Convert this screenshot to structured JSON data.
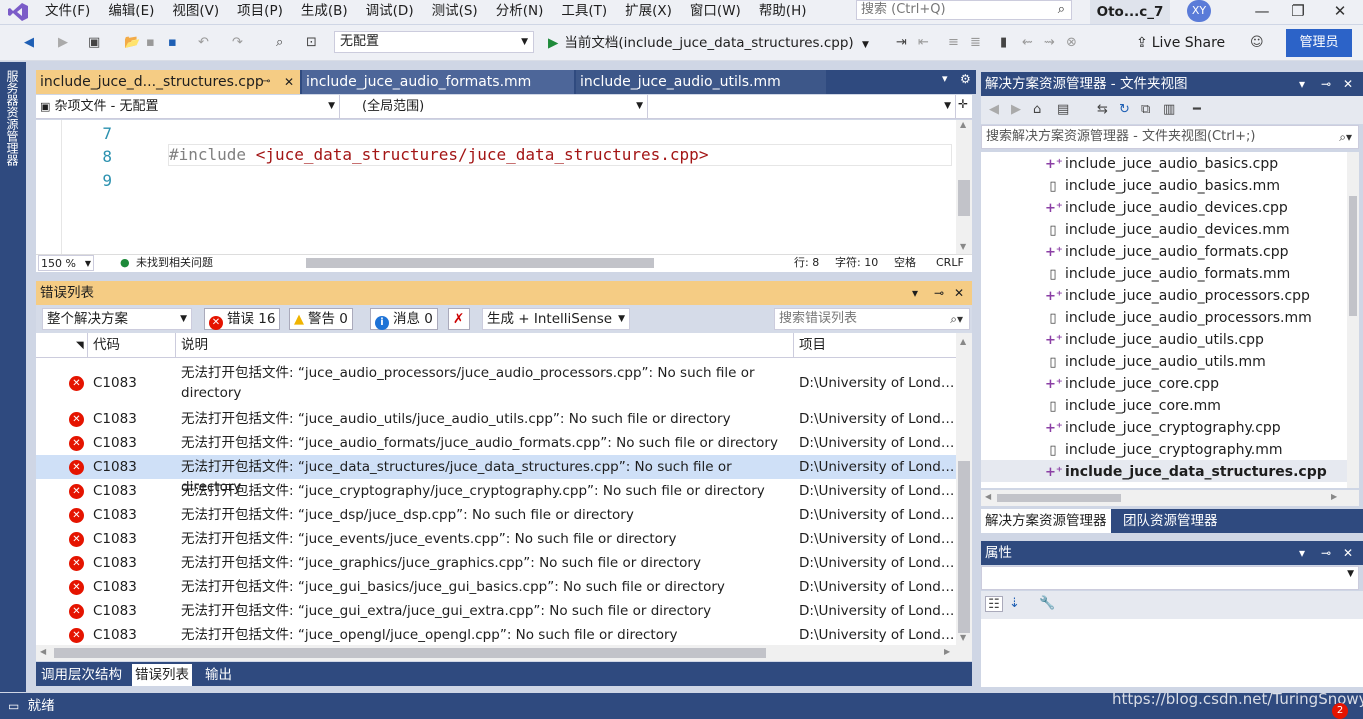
{
  "menu": {
    "items": [
      "文件(F)",
      "编辑(E)",
      "视图(V)",
      "项目(P)",
      "生成(B)",
      "调试(D)",
      "测试(S)",
      "分析(N)",
      "工具(T)",
      "扩展(X)",
      "窗口(W)",
      "帮助(H)"
    ],
    "search_placeholder": "搜索 (Ctrl+Q)",
    "project_title": "Oto...c_7",
    "avatar_initials": "XY"
  },
  "toolbar": {
    "config": "无配置",
    "run_label": "当前文档(include_juce_data_structures.cpp)",
    "liveshare": "Live Share",
    "admin": "管理员"
  },
  "left_strip": {
    "label": "服务器资源管理器"
  },
  "doc_tabs": [
    {
      "label": "include_juce_d..._structures.cpp"
    },
    {
      "label": "include_juce_audio_formats.mm"
    },
    {
      "label": "include_juce_audio_utils.mm"
    }
  ],
  "nav": {
    "file_scope": "杂项文件 - 无配置",
    "scope": "(全局范围)"
  },
  "editor": {
    "line_numbers": [
      "7",
      "8",
      "9"
    ],
    "directive": "#include",
    "include_path": "<juce_data_structures/juce_data_structures.cpp>",
    "zoom": "150 %",
    "no_issues": "未找到相关问题",
    "row": "行: 8",
    "col": "字符: 10",
    "spaces": "空格",
    "eol": "CRLF"
  },
  "error_list": {
    "title": "错误列表",
    "scope": "整个解决方案",
    "errors_label": "错误 16",
    "warnings_label": "警告 0",
    "messages_label": "消息 0",
    "build_filter": "生成 + IntelliSense",
    "search_placeholder": "搜索错误列表",
    "columns": {
      "code": "代码",
      "desc": "说明",
      "project": "项目"
    },
    "rows": [
      {
        "code": "C1083",
        "desc": "无法打开包括文件: “juce_audio_processors/juce_audio_processors.cpp”: No such file or directory",
        "project": "D:\\University of Londo..."
      },
      {
        "code": "C1083",
        "desc": "无法打开包括文件: “juce_audio_utils/juce_audio_utils.cpp”: No such file or directory",
        "project": "D:\\University of Londo..."
      },
      {
        "code": "C1083",
        "desc": "无法打开包括文件: “juce_audio_formats/juce_audio_formats.cpp”: No such file or directory",
        "project": "D:\\University of Londo..."
      },
      {
        "code": "C1083",
        "desc": "无法打开包括文件: “juce_data_structures/juce_data_structures.cpp”: No such file or directory",
        "project": "D:\\University of Londo..."
      },
      {
        "code": "C1083",
        "desc": "无法打开包括文件: “juce_cryptography/juce_cryptography.cpp”: No such file or directory",
        "project": "D:\\University of Londo..."
      },
      {
        "code": "C1083",
        "desc": "无法打开包括文件: “juce_dsp/juce_dsp.cpp”: No such file or directory",
        "project": "D:\\University of Londo..."
      },
      {
        "code": "C1083",
        "desc": "无法打开包括文件: “juce_events/juce_events.cpp”: No such file or directory",
        "project": "D:\\University of Londo..."
      },
      {
        "code": "C1083",
        "desc": "无法打开包括文件: “juce_graphics/juce_graphics.cpp”: No such file or directory",
        "project": "D:\\University of Londo..."
      },
      {
        "code": "C1083",
        "desc": "无法打开包括文件: “juce_gui_basics/juce_gui_basics.cpp”: No such file or directory",
        "project": "D:\\University of Londo..."
      },
      {
        "code": "C1083",
        "desc": "无法打开包括文件: “juce_gui_extra/juce_gui_extra.cpp”: No such file or directory",
        "project": "D:\\University of Londo..."
      },
      {
        "code": "C1083",
        "desc": "无法打开包括文件: “juce_opengl/juce_opengl.cpp”: No such file or directory",
        "project": "D:\\University of Londo..."
      }
    ]
  },
  "bottom_tabs": [
    "调用层次结构",
    "错误列表",
    "输出"
  ],
  "solution": {
    "title": "解决方案资源管理器 - 文件夹视图",
    "search_placeholder": "搜索解决方案资源管理器 - 文件夹视图(Ctrl+;)",
    "files": [
      {
        "name": "include_juce_audio_basics.cpp",
        "kind": "cpp"
      },
      {
        "name": "include_juce_audio_basics.mm",
        "kind": "mm"
      },
      {
        "name": "include_juce_audio_devices.cpp",
        "kind": "cpp"
      },
      {
        "name": "include_juce_audio_devices.mm",
        "kind": "mm"
      },
      {
        "name": "include_juce_audio_formats.cpp",
        "kind": "cpp"
      },
      {
        "name": "include_juce_audio_formats.mm",
        "kind": "mm"
      },
      {
        "name": "include_juce_audio_processors.cpp",
        "kind": "cpp"
      },
      {
        "name": "include_juce_audio_processors.mm",
        "kind": "mm"
      },
      {
        "name": "include_juce_audio_utils.cpp",
        "kind": "cpp"
      },
      {
        "name": "include_juce_audio_utils.mm",
        "kind": "mm"
      },
      {
        "name": "include_juce_core.cpp",
        "kind": "cpp"
      },
      {
        "name": "include_juce_core.mm",
        "kind": "mm"
      },
      {
        "name": "include_juce_cryptography.cpp",
        "kind": "cpp"
      },
      {
        "name": "include_juce_cryptography.mm",
        "kind": "mm"
      },
      {
        "name": "include_juce_data_structures.cpp",
        "kind": "cpp"
      }
    ],
    "tabs": [
      "解决方案资源管理器",
      "团队资源管理器"
    ]
  },
  "properties": {
    "title": "属性"
  },
  "statusbar": {
    "text": "就绪"
  },
  "watermark": "https://blog.csdn.net/TuringSnowy",
  "notifications": "2"
}
